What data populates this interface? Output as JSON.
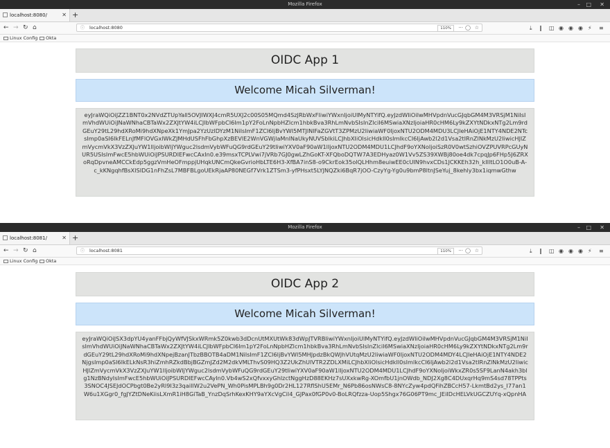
{
  "windows": [
    {
      "title_bar": "Mozilla Firefox",
      "tab_title": "localhost:8080/",
      "url": "localhost:8080",
      "zoom": "110%",
      "bookmarks": [
        "Linux Config",
        "Okta"
      ],
      "app_title": "OIDC App 1",
      "welcome": "Welcome Micah Silverman!",
      "token": "eyJraWQiOiJZZ1BNT0x2NVdZTUpYall5OVJIWXJ4cmR5UXJ2c00S05MQmd4SzJRbWxFliwiYWxnIjoiUlMyNTYifQ.eyJzdWIiOiIwMHVpdnVucGJqbGM4M3VRSjM1NiIsImVhdWUiOiJNaWNhaCBTaWx2ZXJtYW4iLCJlbWFpbCI6Im1pY2FoLnNpbHZlcm1hbkBva3RhLmNvbSIsInZlciI6MSwiaXNzIjoiaHR0cHM6Ly9kZXYtNDkxNTg2Lm9rdGEuY29tL29hdXRoMi9hdXNpeXk1YmJpa2YzUzlDYzM1NiIsImF1ZCI6IjBvYWI5MTJlNlFaZGVtT3ZPMzU2IiwiaWF0IjoxNTU2ODM4MDU3LCJleHAiOjE1NTY4NDE2NTcsImp0aSI6IkFELnJfMFlOVGxlWkZJMHdUSFhFbGhpXzBEVlE2WnVGWjlaMnlNaUkyNUVSblkiLCJhbXIiOlsicHdkIl0sImlkcCI6IjAwb2l2d1Vsa2tIRnZlNkMzU2IiwicHJlZmVycmVkX3VzZXJuYW1lIjoibWljYWguc2lsdmVybWFuQG9rdGEuY29tIiwiYXV0aF90aW1lIjoxNTU2ODM4MDU1LCJhdF9oYXNoIjoiSzR0V0wtSzhiOVZPUVRPcGUyNUR5USIsImFwcE5hbWUiOiJPSURDIEFwcCAxIn0.e39msxTCPLVwi7jVRb7GJ0gwLZhGoKT-XFQboDQTW7A3EDHyaz0W1Vv5ZS39XWBj80oe4dk7cpqJp6FHp5J6ZRXoRqDpvneAMCCkEdp5ggzVmHeOFmppjUHqkUNCmQkeGvrioHbLTE6H3-XfBA7inS8-o9CkrEok35olQLHhm8euiwEE0cUIN9hvxCDs1JCKKEh32h_kIIltLO1O0uB-A-c_kKNgqhfBsXISIDG1nFhZsL7MBFBLgoUEkRjaAP80NEGf7Vrk1ZTSm3-yfPHsxt5LYJNQZki6BqR7jOO-CzyYg-Yg0u9bmP8ltnJSeYuj_8kehly3bx1iqmwGthw"
    },
    {
      "title_bar": "Mozilla Firefox",
      "tab_title": "localhost:8081/",
      "url": "localhost:8081",
      "zoom": "110%",
      "bookmarks": [
        "Linux Config",
        "Okta"
      ],
      "app_title": "OIDC App 2",
      "welcome": "Welcome Micah Silverman!",
      "token": "eyJraWQiOiJSX3dpYU4yanFFbjQyWfVJSkxWRmk5Z0kwb3dDcnUtMXUtWk83dWpJTVRBliwiYWxnIjoiUlMyNTYifQ.eyJzdWIiOiIwMHVpdnVucGJqbGM4M3VRSjM1NiIsImVhdWUiOiJNaWNhaCBTaWx2ZXJtYW4iLCJlbWFpbCI6Im1pY2FoLnNpbHZlcm1hbkBva3RhLmNvbSIsInZlciI6MSwiaXNzIjoiaHR0cHM6Ly9kZXYtNDkxNTg2Lm9rdGEuY29tL29hdXRoMi9hdXNpejBzanJTbzBBOTB4aDM1NiIsImF1ZCI6IjBvYWI5MHJpdzBkQWJhVUtqMzU2IiwiaWF0IjoxNTU2ODM4MDY4LCJleHAiOjE1NTY4NDE2NjgsImp0aSI6IkELkNsR3hiZmhRZkdBbjBGZmJZd2M2dkVMLThvS09HQ3Z2UkZhUlVTR2ZDLXMiLCJhbXIiOlsicHdkIl0sImlkcCI6IjAwb2l2d1Vsa2tIRnZlNkMzU2IiwicHJlZmVycmVkX3VzZXJuYW1lIjoibWljYWguc2lsdmVybWFuQG9rdGEuY29tIiwiYXV0aF90aW1lIjoxNTU2ODM4MDU1LCJhdF9oYXNoIjoiWkxZR0s5SF9LanN4akh3blg1NzBNdyIsImFwcE5hbWUiOiJPSURDIEFwcCAyIn0.Vb4wS2xQfvxxyGhlzctNggHzD88EKHz7sUXxkwRg-XOmfbU1jnOWdb_NDJ2Xg8C4DUxqrHq9mS4sd78TPPts3SNOC4JSEJdOCPbgt0Be2yRl9I3z3qaiIlW2u2VePN_Wh0PisMPLBh9g0Dr2HL127RflShU5EMr_N6Pb86osNWsC8-8NYcZyw4pdQFihZBCcH57-LkmtBd2ys_I77an1W6u1XGgr0_fgJYZtDNeKiisLXmR1iH8GiTaB_YnzDqSrhKexKHY9aYXcVgCil4_GJPax0fGP0v0-BoLRQfzza-Uop5Shgx76G06PT9mc_JEiIDcHELVkUGCZUYq-xQpnHA"
    }
  ]
}
